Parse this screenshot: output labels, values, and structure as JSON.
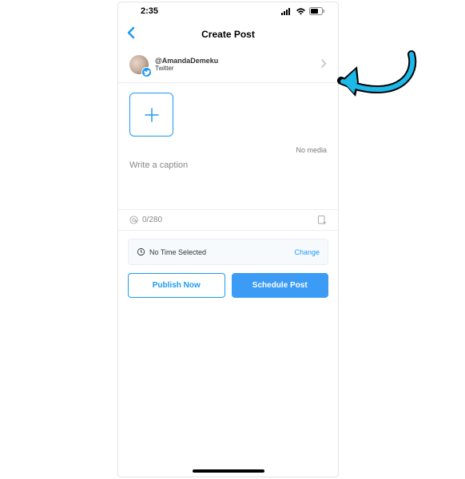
{
  "status_bar": {
    "time": "2:35"
  },
  "header": {
    "title": "Create Post"
  },
  "account": {
    "handle": "@AmandaDemeku",
    "platform": "Twitter"
  },
  "media": {
    "no_media_label": "No media"
  },
  "caption": {
    "placeholder": "Write a caption"
  },
  "counter": {
    "text": "0/280"
  },
  "schedule": {
    "time_label": "No Time Selected",
    "change_label": "Change"
  },
  "buttons": {
    "publish": "Publish Now",
    "schedule": "Schedule Post"
  }
}
